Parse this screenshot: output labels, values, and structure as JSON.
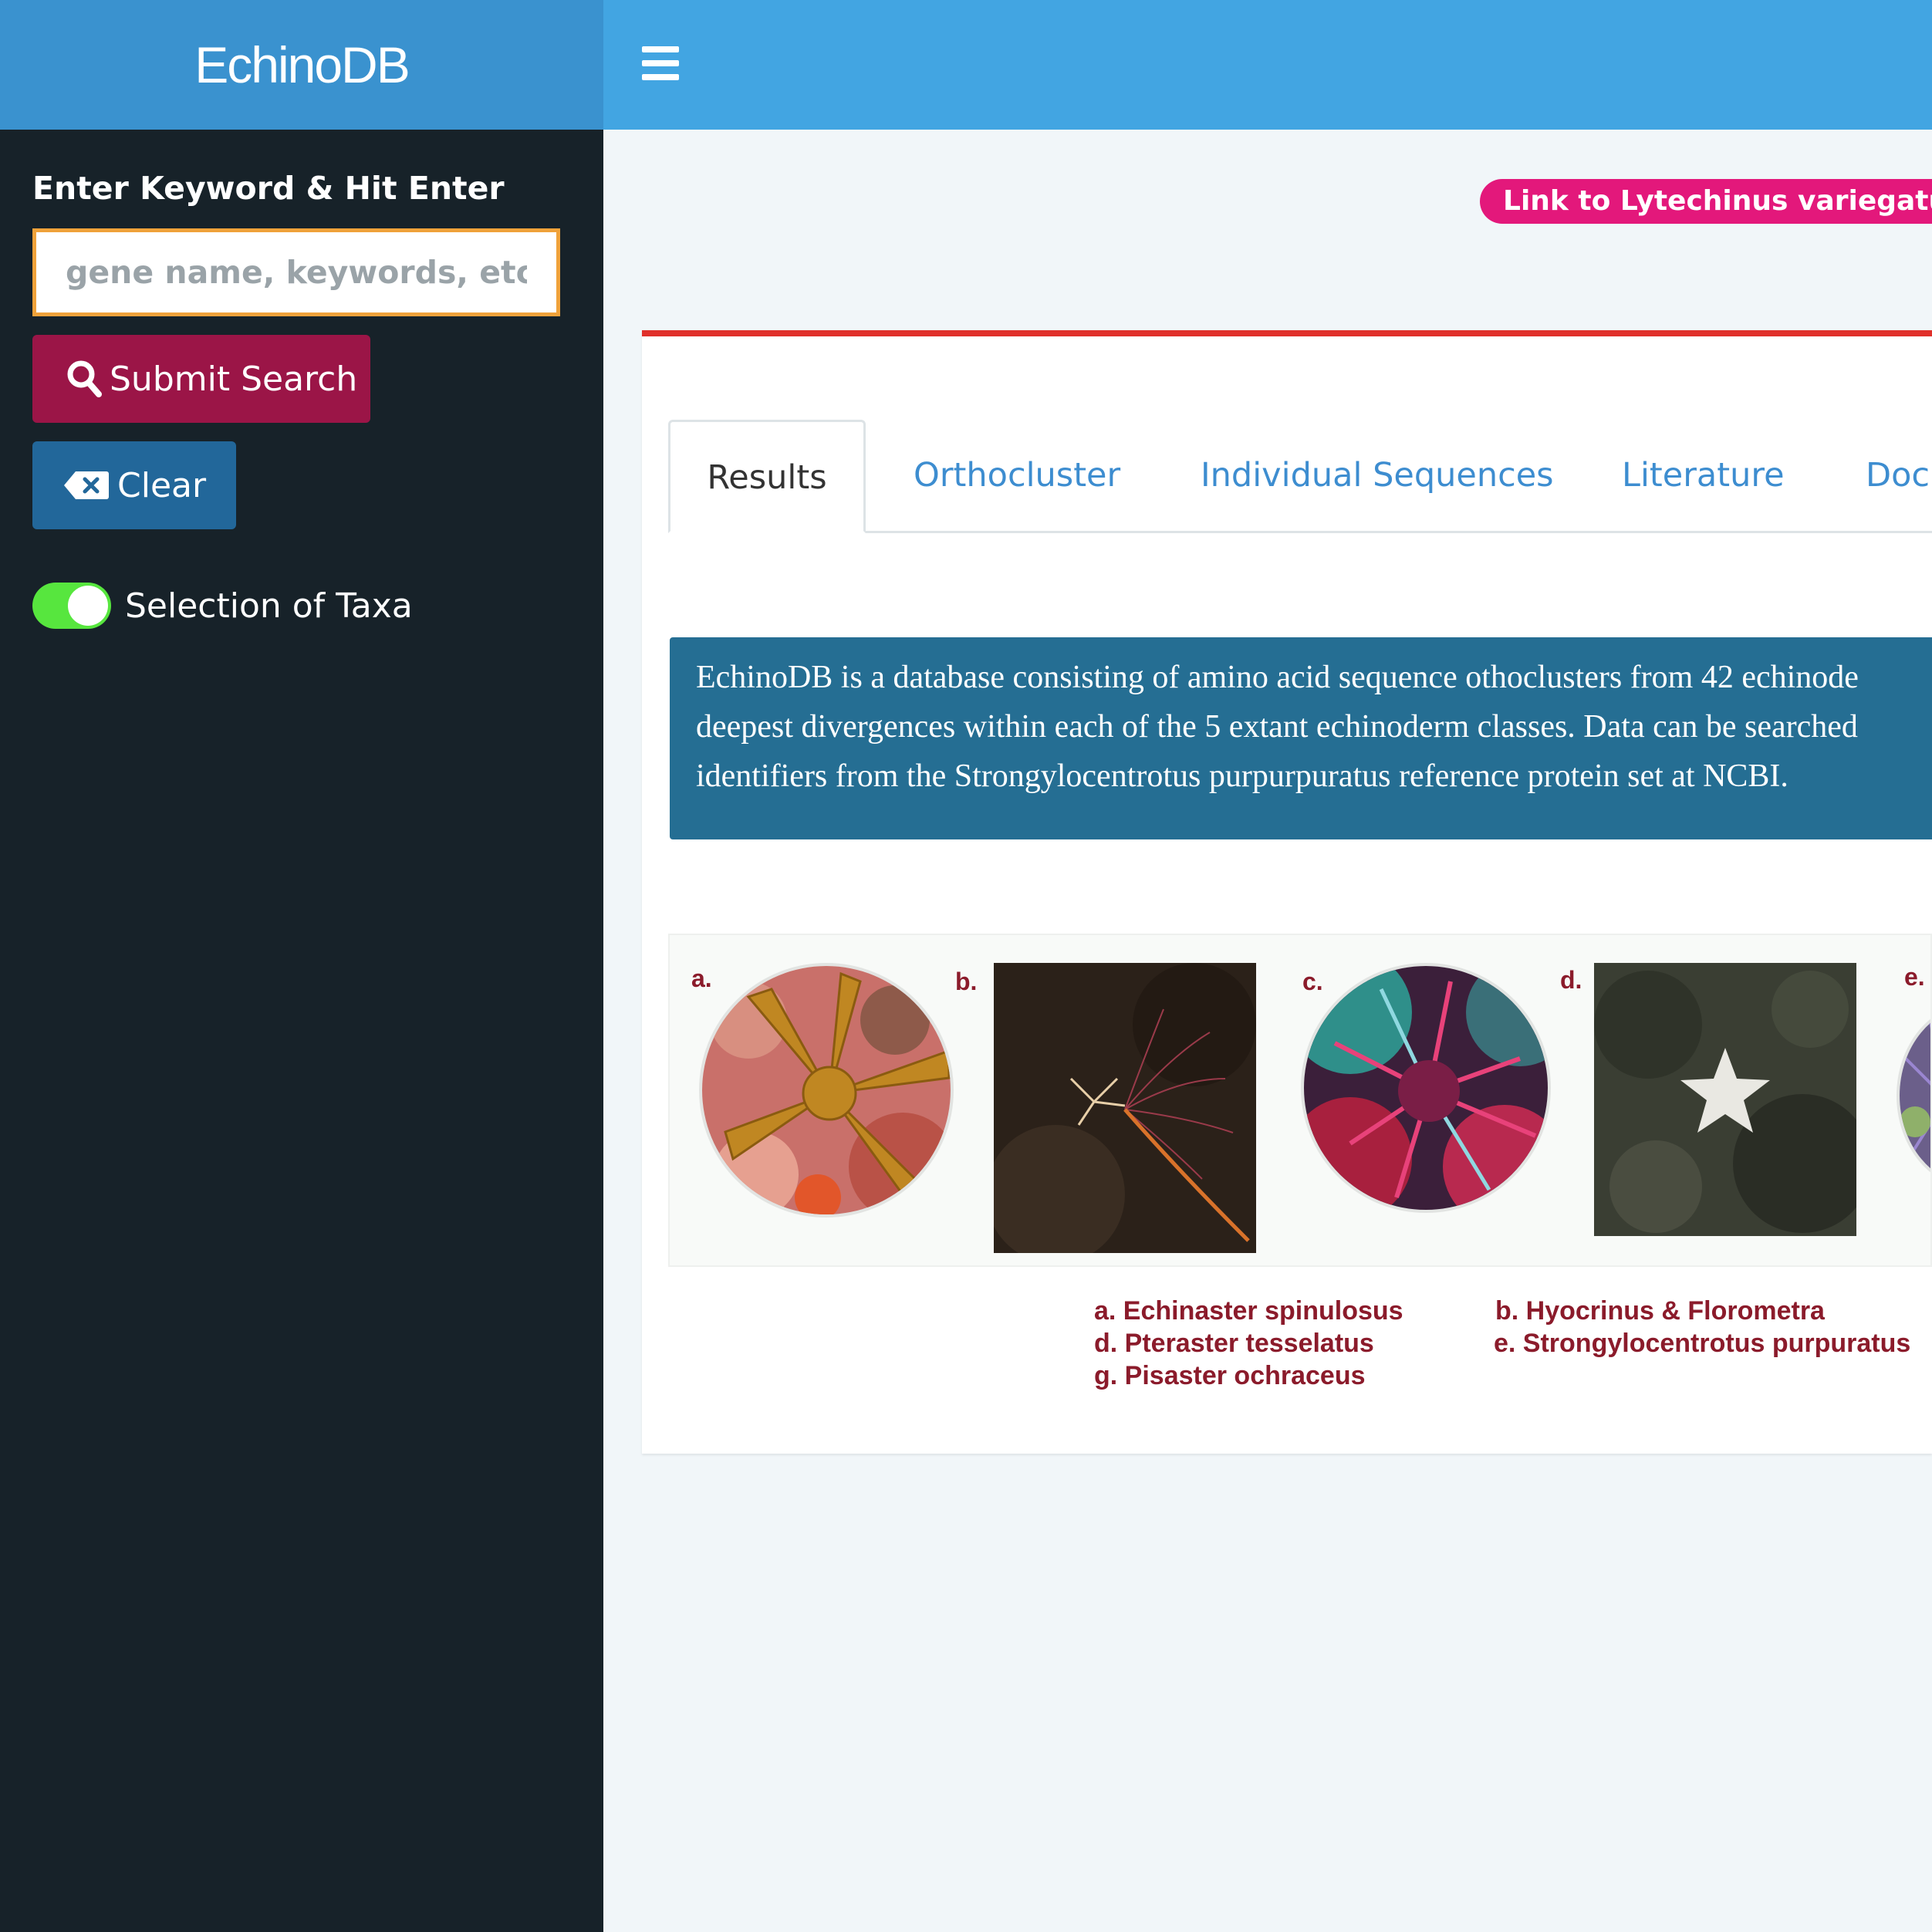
{
  "header": {
    "logo": "EchinoDB",
    "menu_icon": "hamburger-icon"
  },
  "sidebar": {
    "keyword_label": "Enter Keyword & Hit Enter",
    "search_placeholder": "gene name, keywords, etc.",
    "search_value": "",
    "submit_label": "Submit Search",
    "clear_label": "Clear",
    "toggle_label": "Selection of Taxa",
    "toggle_on": true
  },
  "main": {
    "link_pill": "Link to Lytechinus variegatus D",
    "tabs": [
      {
        "label": "Results",
        "active": true
      },
      {
        "label": "Orthocluster"
      },
      {
        "label": "Individual Sequences"
      },
      {
        "label": "Literature"
      },
      {
        "label": "Docu"
      }
    ],
    "info_lines": [
      "EchinoDB is a database consisting of amino acid sequence othoclusters from 42 echinode",
      "deepest divergences within each of the 5 extant echinoderm classes. Data can be searched",
      "identifiers from the Strongylocentrotus purpurpuratus reference protein set at NCBI."
    ],
    "gallery_labels": [
      "a.",
      "b.",
      "c.",
      "d.",
      "e."
    ],
    "captions": {
      "a": "a. Echinaster spinulosus",
      "b": "b. Hyocrinus & Florometra",
      "d": "d. Pteraster tesselatus",
      "e": "e. Strongylocentrotus purpuratus",
      "g": "g. Pisaster ochraceus"
    }
  },
  "colors": {
    "header_left": "#3a92cf",
    "header_right": "#42a5e2",
    "sidebar_bg": "#172229",
    "submit_button": "#9b1547",
    "clear_button": "#22679a",
    "toggle_on": "#57e63e",
    "pill_link": "#e3187b",
    "box_top_border": "#e0302b",
    "info_bg": "#256e93",
    "caption_text": "#8b1b2b"
  }
}
